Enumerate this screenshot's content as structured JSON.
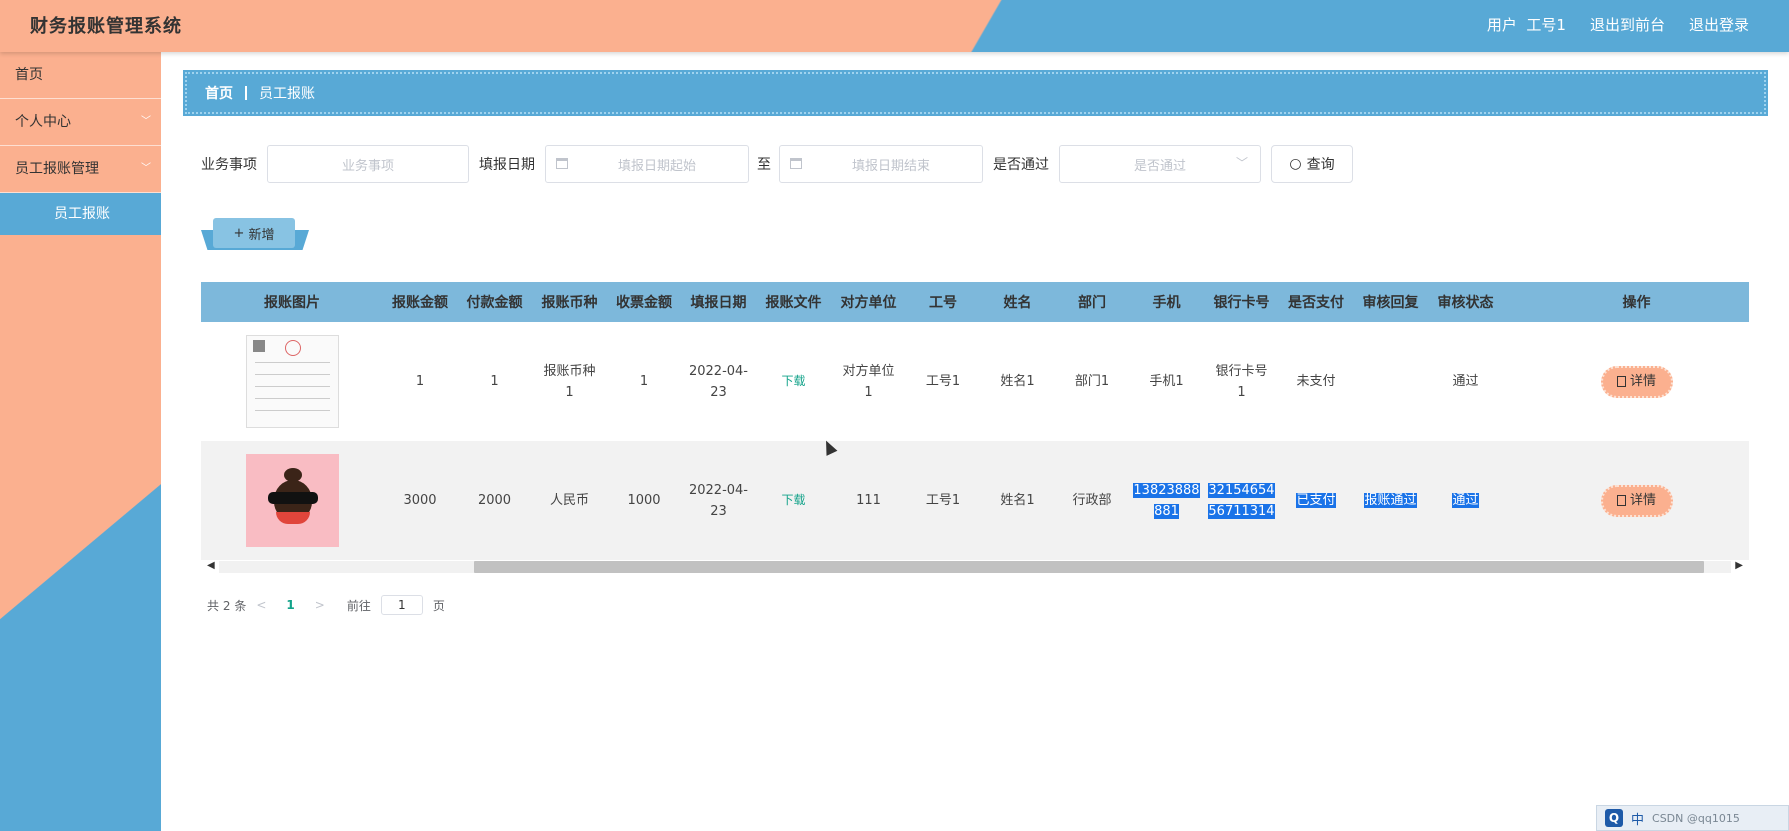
{
  "header": {
    "app_title": "财务报账管理系统",
    "user_label": "用户",
    "user_name": "工号1",
    "to_front": "退出到前台",
    "logout": "退出登录"
  },
  "sidebar": {
    "items": [
      {
        "label": "首页",
        "has_children": false
      },
      {
        "label": "个人中心",
        "has_children": true
      },
      {
        "label": "员工报账管理",
        "has_children": true
      }
    ],
    "active_sub": "员工报账"
  },
  "breadcrumb": {
    "home": "首页",
    "current": "员工报账"
  },
  "search": {
    "field1_label": "业务事项",
    "field1_placeholder": "业务事项",
    "date_label": "填报日期",
    "date_start_placeholder": "填报日期起始",
    "date_to": "至",
    "date_end_placeholder": "填报日期结束",
    "pass_label": "是否通过",
    "pass_placeholder": "是否通过",
    "query_button": "查询"
  },
  "add_button": "新增",
  "table": {
    "headers": [
      "报账图片",
      "报账金额",
      "付款金额",
      "报账币种",
      "收票金额",
      "填报日期",
      "报账文件",
      "对方单位",
      "工号",
      "姓名",
      "部门",
      "手机",
      "银行卡号",
      "是否支付",
      "审核回复",
      "审核状态",
      "操作"
    ],
    "rows": [
      {
        "image": "invoice-thumbnail",
        "amount": "1",
        "paid": "1",
        "currency_l1": "报账币种",
        "currency_l2": "1",
        "invoice_amount": "1",
        "date_l1": "2022-04-",
        "date_l2": "23",
        "file": "下载",
        "partner_l1": "对方单位",
        "partner_l2": "1",
        "emp_no": "工号1",
        "name": "姓名1",
        "dept": "部门1",
        "phone_l1": "手机1",
        "phone_l2": "",
        "card_l1": "银行卡号",
        "card_l2": "1",
        "is_paid": "未支付",
        "reply": "",
        "status": "通过",
        "action": "详情"
      },
      {
        "image": "monkey-thumbnail",
        "amount": "3000",
        "paid": "2000",
        "currency_l1": "人民币",
        "currency_l2": "",
        "invoice_amount": "1000",
        "date_l1": "2022-04-",
        "date_l2": "23",
        "file": "下载",
        "partner_l1": "111",
        "partner_l2": "",
        "emp_no": "工号1",
        "name": "姓名1",
        "dept": "行政部",
        "phone_l1": "13823888",
        "phone_l2": "881",
        "card_l1": "32154654",
        "card_l2": "56711314",
        "is_paid": "已支付",
        "reply": "报账通过",
        "status": "通过",
        "action": "详情"
      }
    ]
  },
  "pagination": {
    "total_prefix": "共",
    "total": "2",
    "total_suffix": "条",
    "current_page": "1",
    "goto_prefix": "前往",
    "goto_value": "1",
    "goto_suffix": "页"
  },
  "taskbar": {
    "ime": "中",
    "watermark": "CSDN @qq1015"
  },
  "colors": {
    "peach": "#fbb08f",
    "blue": "#58a9d6",
    "header_row": "#7db8db",
    "selection": "#1a73e8"
  }
}
